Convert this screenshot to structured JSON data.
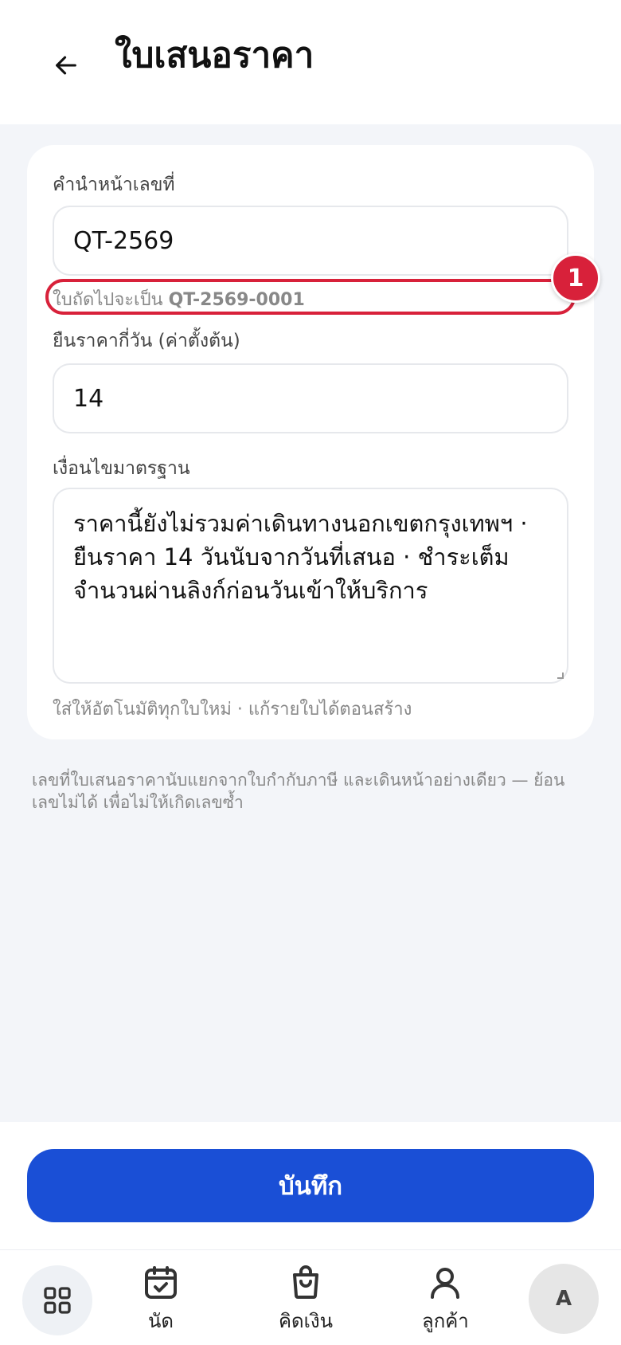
{
  "header": {
    "title": "ใบเสนอราคา",
    "back_icon": "arrow-left-icon"
  },
  "form": {
    "prefix": {
      "label": "คำนำหน้าเลขที่",
      "value": "QT-2569",
      "next_hint_prefix": "ใบถัดไปจะเป็น",
      "next_hint_number": "QT-2569-0001"
    },
    "validity": {
      "label": "ยืนราคากี่วัน (ค่าตั้งต้น)",
      "value": "14"
    },
    "terms": {
      "label": "เงื่อนไขมาตรฐาน",
      "value": "ราคานี้ยังไม่รวมค่าเดินทางนอกเขตกรุงเทพฯ · ยืนราคา 14 วันนับจากวันที่เสนอ · ชำระเต็มจำนวนผ่านลิงก์ก่อนวันเข้าให้บริการ",
      "hint": "ใส่ให้อัตโนมัติทุกใบใหม่ · แก้รายใบได้ตอนสร้าง"
    }
  },
  "annotation": {
    "badge_number": "1",
    "color": "#d8213a"
  },
  "footnote": "เลขที่ใบเสนอราคานับแยกจากใบกำกับภาษี และเดินหน้าอย่างเดียว — ย้อนเลขไม่ได้ เพื่อไม่ให้เกิดเลขซ้ำ",
  "save_button": {
    "label": "บันทึก",
    "color": "#1a4fd6"
  },
  "bottom_nav": {
    "home_icon": "grid-icon",
    "items": [
      {
        "label": "นัด",
        "icon": "calendar-check-icon"
      },
      {
        "label": "คิดเงิน",
        "icon": "shopping-bag-icon"
      },
      {
        "label": "ลูกค้า",
        "icon": "user-icon"
      }
    ],
    "avatar_initial": "A"
  }
}
